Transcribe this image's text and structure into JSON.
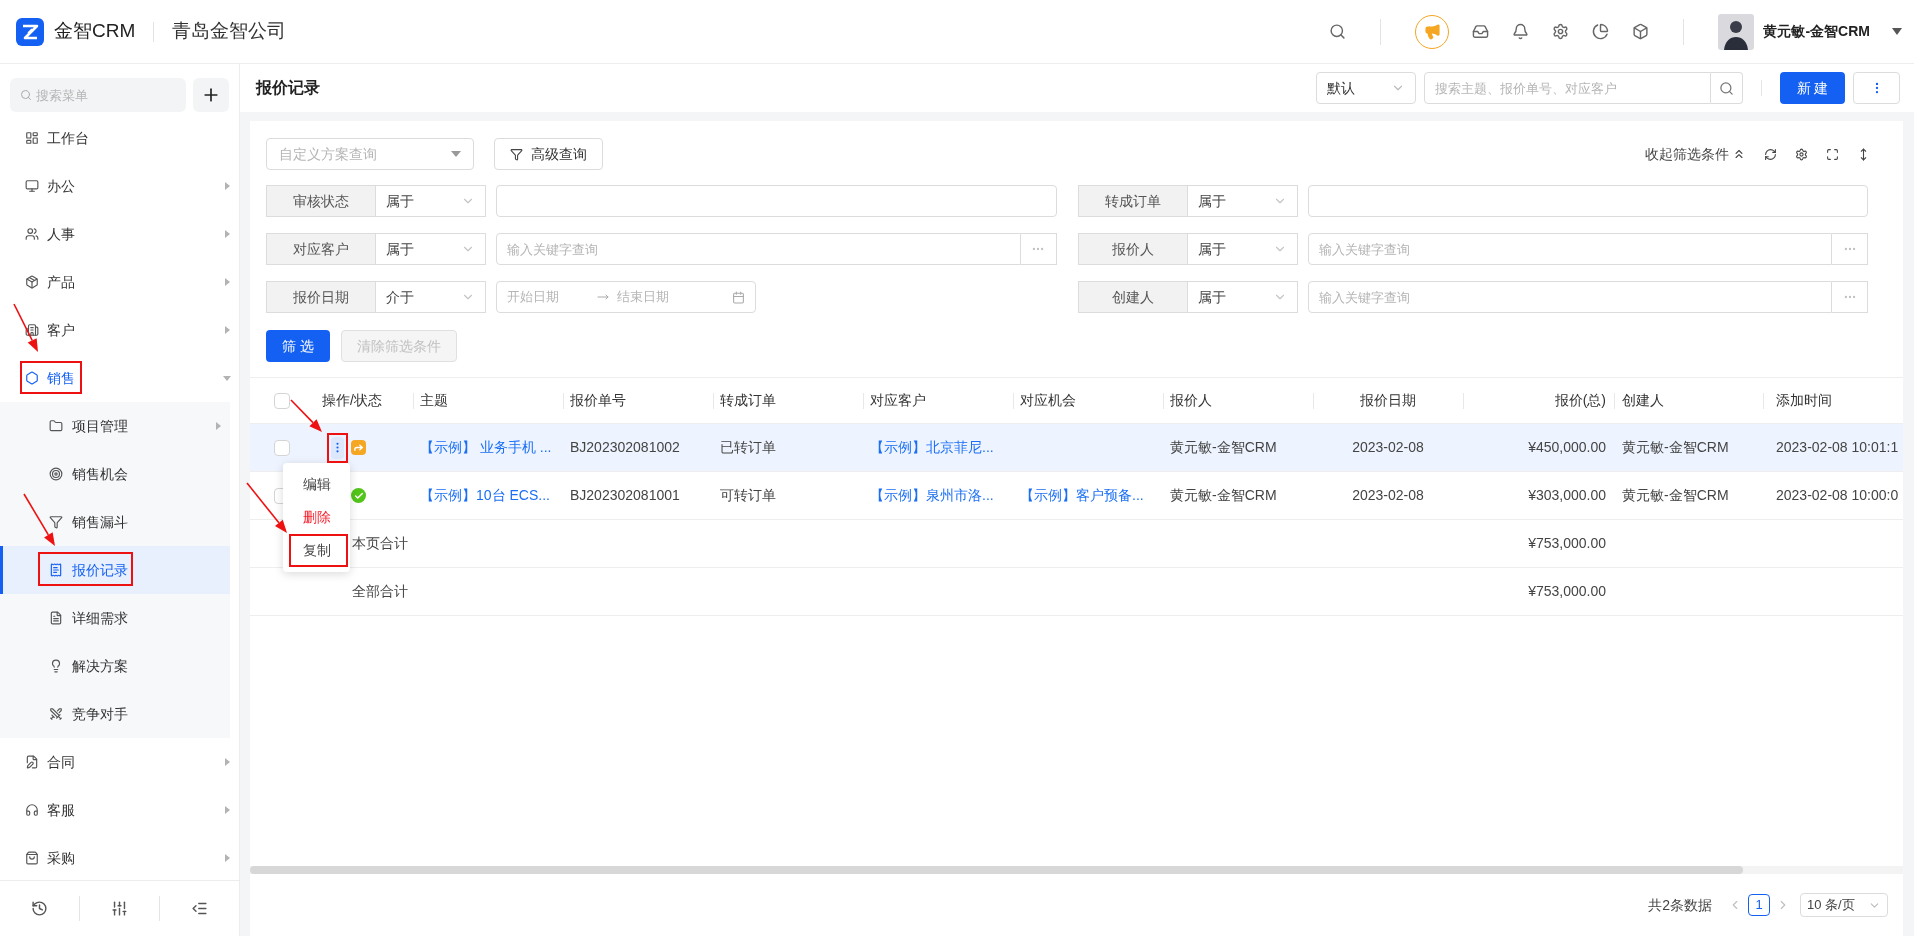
{
  "header": {
    "app_name": "金智CRM",
    "company": "青岛金智公司",
    "user_name": "黄元敏-金智CRM"
  },
  "sidebar": {
    "search_placeholder": "搜索菜单",
    "items": [
      {
        "label": "工作台",
        "expandable": false,
        "selected": false,
        "annotated": false
      },
      {
        "label": "办公",
        "expandable": true,
        "expanded": false,
        "selected": false,
        "annotated": false
      },
      {
        "label": "人事",
        "expandable": true,
        "expanded": false,
        "selected": false,
        "annotated": false
      },
      {
        "label": "产品",
        "expandable": true,
        "expanded": false,
        "selected": false,
        "annotated": false
      },
      {
        "label": "客户",
        "expandable": true,
        "expanded": false,
        "selected": false,
        "annotated": false
      },
      {
        "label": "销售",
        "expandable": true,
        "expanded": true,
        "selected": true,
        "annotated": true,
        "children": [
          {
            "label": "项目管理",
            "expandable": true,
            "expanded": false,
            "selected": false,
            "annotated": false
          },
          {
            "label": "销售机会",
            "expandable": false,
            "selected": false,
            "annotated": false
          },
          {
            "label": "销售漏斗",
            "expandable": false,
            "selected": false,
            "annotated": false
          },
          {
            "label": "报价记录",
            "expandable": false,
            "selected": true,
            "annotated": true
          },
          {
            "label": "详细需求",
            "expandable": false,
            "selected": false,
            "annotated": false
          },
          {
            "label": "解决方案",
            "expandable": false,
            "selected": false,
            "annotated": false
          },
          {
            "label": "竞争对手",
            "expandable": false,
            "selected": false,
            "annotated": false
          }
        ]
      },
      {
        "label": "合同",
        "expandable": true,
        "expanded": false,
        "selected": false,
        "annotated": false
      },
      {
        "label": "客服",
        "expandable": true,
        "expanded": false,
        "selected": false,
        "annotated": false
      },
      {
        "label": "采购",
        "expandable": true,
        "expanded": false,
        "selected": false,
        "annotated": false
      }
    ]
  },
  "page": {
    "title": "报价记录",
    "view_select": "默认",
    "search_placeholder": "搜索主题、报价单号、对应客户",
    "new_button": "新 建"
  },
  "filters": {
    "scheme_placeholder": "自定义方案查询",
    "advanced_button": "高级查询",
    "collapse_label": "收起筛选条件",
    "conditions": [
      {
        "kind": "text",
        "label": "审核状态",
        "operator": "属于"
      },
      {
        "kind": "text",
        "label": "转成订单",
        "operator": "属于"
      },
      {
        "kind": "lookup",
        "label": "对应客户",
        "operator": "属于",
        "placeholder": "输入关键字查询"
      },
      {
        "kind": "lookup",
        "label": "报价人",
        "operator": "属于",
        "placeholder": "输入关键字查询"
      },
      {
        "kind": "date",
        "label": "报价日期",
        "operator": "介于",
        "start_placeholder": "开始日期",
        "end_placeholder": "结束日期"
      },
      {
        "kind": "lookup",
        "label": "创建人",
        "operator": "属于",
        "placeholder": "输入关键字查询"
      }
    ],
    "apply_button": "筛 选",
    "clear_button": "清除筛选条件",
    "clear_disabled": true
  },
  "table": {
    "header_checked": false,
    "columns": [
      "操作/状态",
      "主题",
      "报价单号",
      "转成订单",
      "对应客户",
      "对应机会",
      "报价人",
      "报价日期",
      "报价(总)",
      "创建人",
      "添加时间"
    ],
    "rows": [
      {
        "highlighted": true,
        "checked": false,
        "menu_open": true,
        "annotated": true,
        "kind": "converted",
        "subject": "【示例】 业务手机 ...",
        "number": "BJ202302081002",
        "order_status": "已转订单",
        "customer": "【示例】北京菲尼...",
        "quoter": "黄元敏-金智CRM",
        "date": "2023-02-08",
        "amount": "¥450,000.00",
        "creator": "黄元敏-金智CRM",
        "added_time": "2023-02-08 10:01:1"
      },
      {
        "highlighted": false,
        "checked": false,
        "menu_open": false,
        "annotated": false,
        "kind": "approved",
        "subject": "【示例】10台 ECS...",
        "number": "BJ202302081001",
        "order_status": "可转订单",
        "customer": "【示例】泉州市洛...",
        "opportunity": "【示例】客户预备...",
        "quoter": "黄元敏-金智CRM",
        "date": "2023-02-08",
        "amount": "¥303,000.00",
        "creator": "黄元敏-金智CRM",
        "added_time": "2023-02-08 10:00:0"
      }
    ],
    "totals": [
      {
        "label": "本页合计",
        "amount": "¥753,000.00"
      },
      {
        "label": "全部合计",
        "amount": "¥753,000.00"
      }
    ]
  },
  "row_menu": {
    "items": [
      {
        "kind": "normal",
        "label": "编辑",
        "annotated": false
      },
      {
        "kind": "danger",
        "label": "删除",
        "annotated": false
      },
      {
        "kind": "normal",
        "label": "复制",
        "annotated": true
      }
    ]
  },
  "pagination": {
    "total": "共2条数据",
    "pages": [
      {
        "label": "1",
        "selected": true
      }
    ],
    "page_size": "10 条/页"
  }
}
